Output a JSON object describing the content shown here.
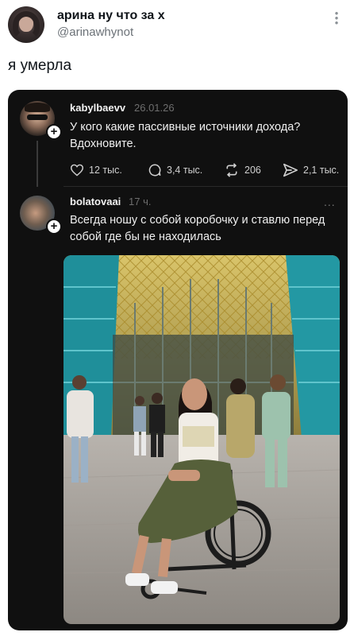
{
  "outer_tweet": {
    "display_name": "арина ну что за х",
    "handle": "@arinawhynot",
    "text": "я умерла",
    "more_icon": "more-vertical-icon"
  },
  "embedded_post": {
    "author": "kabylbaevv",
    "time": "26.01.26",
    "text": "У кого какие пассивные источники дохода? Вдохновите.",
    "likes": "12 тыс.",
    "replies": "3,4 тыс.",
    "reposts": "206",
    "shares": "2,1 тыс."
  },
  "reply": {
    "author": "bolatovaai",
    "time": "17 ч.",
    "more": "...",
    "text": "Всегда ношу с собой коробочку и ставлю перед собой где бы не находилась"
  },
  "colors": {
    "card_bg": "#101010",
    "teal_building": "#1f8f9a",
    "gold_ceiling": "#d8b23c"
  }
}
